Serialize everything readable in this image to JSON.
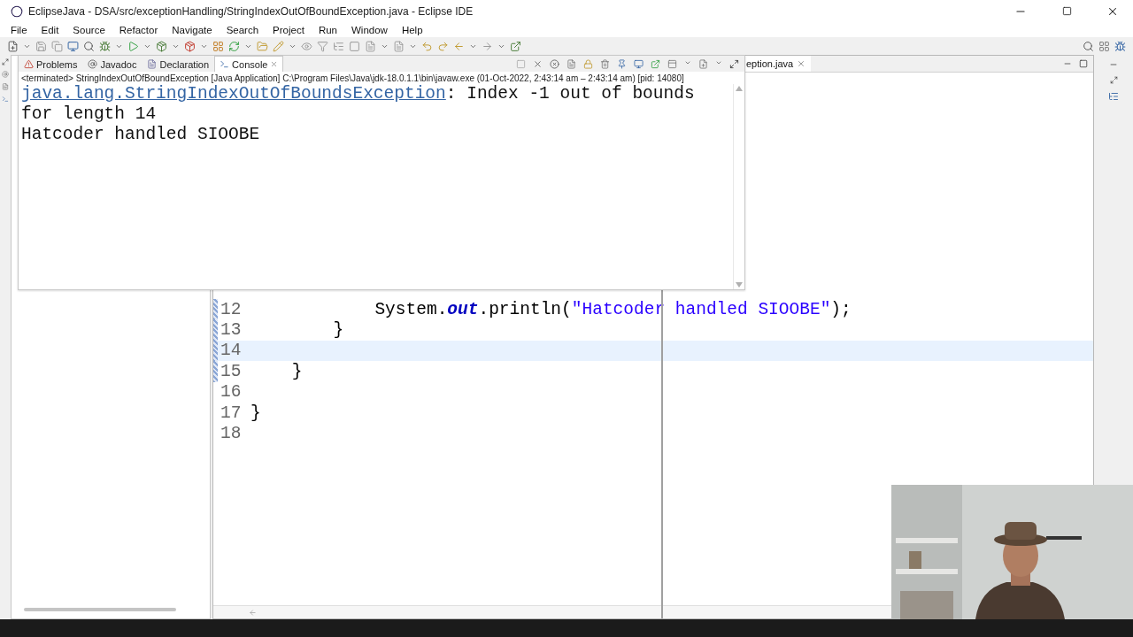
{
  "window": {
    "title": "EclipseJava - DSA/src/exceptionHandling/StringIndexOutOfBoundException.java - Eclipse IDE"
  },
  "menu": [
    "File",
    "Edit",
    "Source",
    "Refactor",
    "Navigate",
    "Search",
    "Project",
    "Run",
    "Window",
    "Help"
  ],
  "console": {
    "tabs": [
      {
        "label": "Problems",
        "kind": "problems",
        "selected": false
      },
      {
        "label": "Javadoc",
        "kind": "javadoc",
        "selected": false
      },
      {
        "label": "Declaration",
        "kind": "declaration",
        "selected": false
      },
      {
        "label": "Console",
        "kind": "console",
        "selected": true
      }
    ],
    "status": "<terminated> StringIndexOutOfBoundException [Java Application] C:\\Program Files\\Java\\jdk-18.0.1.1\\bin\\javaw.exe  (01-Oct-2022, 2:43:14 am – 2:43:14 am) [pid: 14080]",
    "output": [
      {
        "kind": "error",
        "link": "java.lang.StringIndexOutOfBoundsException",
        "text": ": Index -1 out of bounds for length 14"
      },
      {
        "kind": "plain",
        "text": "Hatcoder handled SIOOBE"
      }
    ]
  },
  "editor": {
    "tab": "eption.java",
    "lines": [
      {
        "number": "12",
        "changed": true,
        "current": false,
        "segments": [
          {
            "kind": "plain",
            "text": "            System."
          },
          {
            "kind": "field",
            "text": "out"
          },
          {
            "kind": "plain",
            "text": ".println("
          },
          {
            "kind": "string",
            "text": "\"Hatcoder handled SIOOBE\""
          },
          {
            "kind": "plain",
            "text": ");"
          }
        ]
      },
      {
        "number": "13",
        "changed": true,
        "current": false,
        "segments": [
          {
            "kind": "plain",
            "text": "        }"
          }
        ]
      },
      {
        "number": "14",
        "changed": true,
        "current": true
      },
      {
        "number": "15",
        "changed": true,
        "current": false,
        "segments": [
          {
            "kind": "plain",
            "text": "    }"
          }
        ]
      },
      {
        "number": "16",
        "changed": false,
        "current": false
      },
      {
        "number": "17",
        "changed": false,
        "current": false,
        "segments": [
          {
            "kind": "plain",
            "text": "}"
          }
        ]
      },
      {
        "number": "18",
        "changed": false,
        "current": false
      }
    ]
  }
}
